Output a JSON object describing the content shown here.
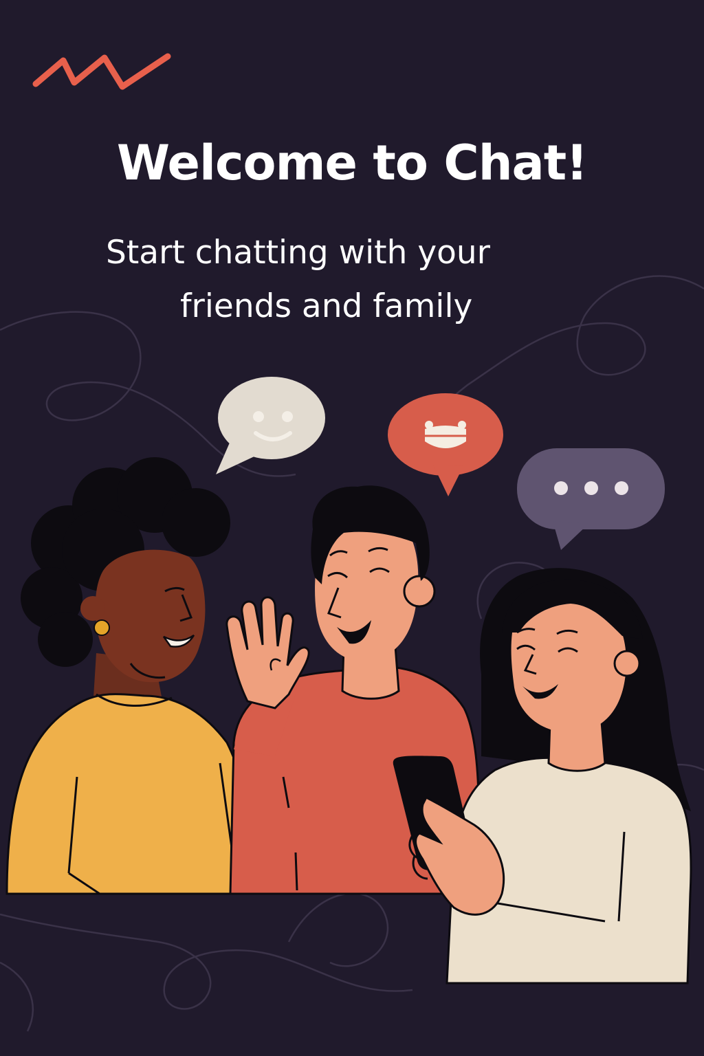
{
  "app": {
    "logo_icon": "zigzag-logo-icon",
    "accent_color": "#e8604c"
  },
  "hero": {
    "title": "Welcome to Chat!",
    "subtitle_line1": "Start chatting with your",
    "subtitle_line2": "friends and family"
  },
  "illustration": {
    "bubbles": [
      "smile-bubble-icon",
      "laugh-bubble-icon",
      "typing-bubble-icon"
    ],
    "people": [
      "person-yellow-sweater",
      "person-waving",
      "person-with-phone"
    ],
    "colors": {
      "background": "#201a2c",
      "yellow": "#efb04a",
      "red": "#d75d4b",
      "cream": "#ece0cc",
      "purple": "#5f5470"
    }
  }
}
